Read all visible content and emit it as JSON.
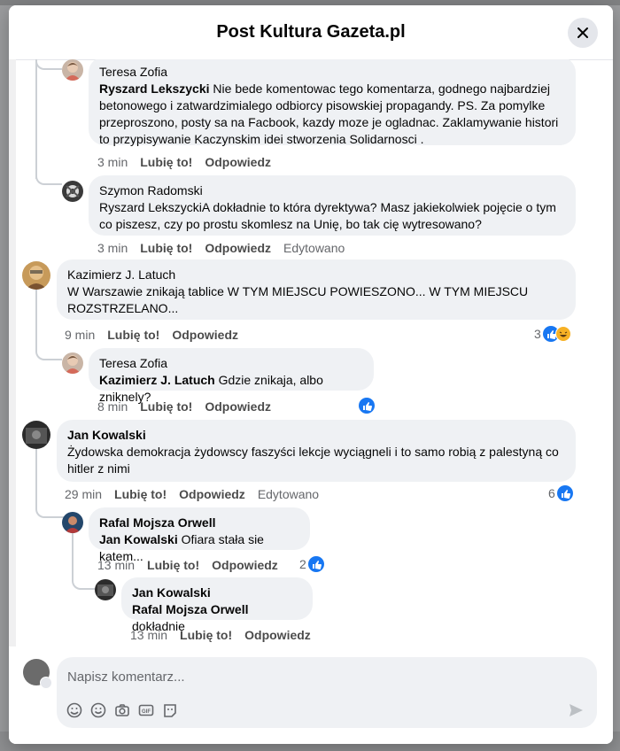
{
  "header": {
    "title": "Post Kultura Gazeta.pl"
  },
  "actions": {
    "like": "Lubię to!",
    "reply": "Odpowiedz",
    "edited": "Edytowano"
  },
  "comments": [
    {
      "author": "Teresa Zofia",
      "tag": "Ryszard Lekszycki",
      "text": " Nie bede komentowac tego komentarza, godnego najbardziej betonowego i zatwardzimialego odbiorcy pisowskiej propagandy. PS. Za pomylke przeproszono, posty sa na Facbook, kazdy moze je ogladnac. Zaklamywanie histori to przypisywanie Kaczynskim idei stworzenia Solidarnosci .",
      "time": "3 min"
    },
    {
      "author": "Szymon Radomski",
      "tag": "",
      "text": "Ryszard LekszyckiA dokładnie to która dyrektywa? Masz jakiekolwiek pojęcie o tym co piszesz, czy po prostu skomlesz na Unię, bo tak cię wytresowano?",
      "time": "3 min"
    },
    {
      "author": "Kazimierz J. Latuch",
      "tag": "",
      "text": "W Warszawie znikają tablice W TYM MIEJSCU POWIESZONO... W TYM MIEJSCU ROZSTRZELANO...",
      "time": "9 min",
      "reactions": "3"
    },
    {
      "author": "Teresa Zofia",
      "tag": "Kazimierz J. Latuch",
      "text": " Gdzie znikaja, albo zniknely?",
      "time": "8 min"
    },
    {
      "author": "Jan Kowalski",
      "tag": "",
      "text": "Żydowska demokracja żydowscy faszyści lekcje wyciągneli i to samo robią z palestyną co hitler z nimi",
      "time": "29 min",
      "reactions": "6"
    },
    {
      "author": "Rafal Mojsza Orwell",
      "tag": "Jan Kowalski",
      "text": " Ofiara stała sie katem...",
      "time": "13 min",
      "reactions": "2"
    },
    {
      "author": "Jan Kowalski",
      "tag": "Rafal Mojsza Orwell",
      "text": " dokładnie",
      "time": "13 min"
    }
  ],
  "composer": {
    "placeholder": "Napisz komentarz..."
  },
  "icons": {
    "close": "close-icon",
    "like": "like-reaction-icon",
    "haha": "haha-reaction-icon",
    "sticker": "sticker-icon",
    "emoji": "emoji-icon",
    "camera": "camera-icon",
    "gif": "gif-icon",
    "avatar_sticker": "avatar-sticker-icon",
    "send": "send-icon"
  },
  "colors": {
    "like_blue": "#1877f2",
    "bubble": "#eff1f4",
    "muted": "#65676b"
  }
}
